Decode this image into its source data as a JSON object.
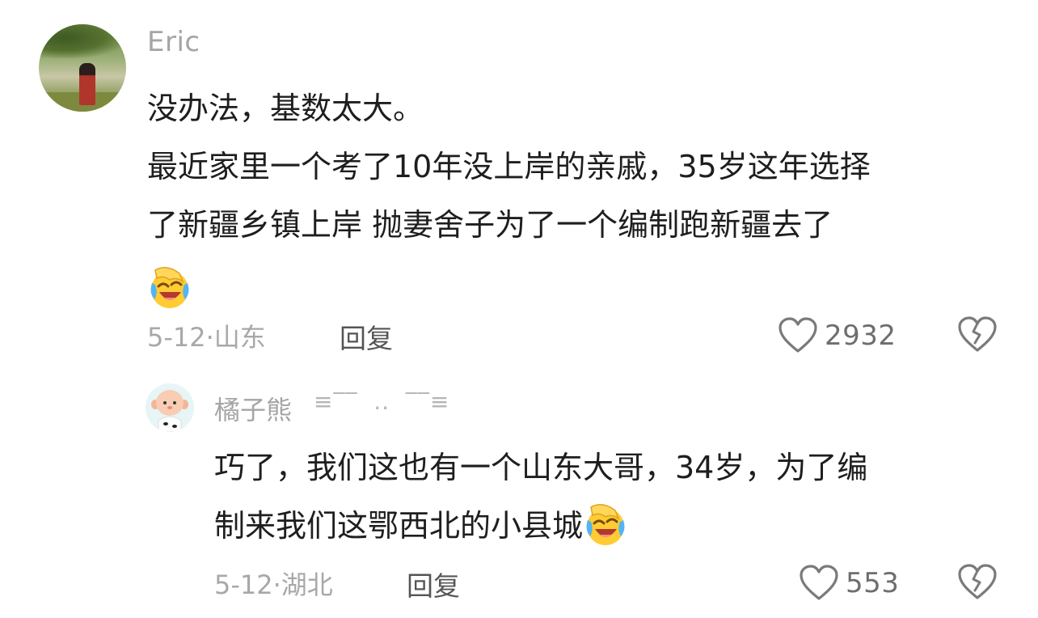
{
  "comment": {
    "username": "Eric",
    "lines": [
      "没办法，基数太大。",
      "最近家里一个考了10年没上岸的亲戚，35岁这年选择",
      "了新疆乡镇上岸 抛妻舍子为了一个编制跑新疆去了"
    ],
    "emoji": "😂",
    "date": "5-12",
    "separator": "·",
    "location": "山东",
    "reply_label": "回复",
    "like_count": "2932",
    "icons": {
      "like": "heart-outline-icon",
      "dislike": "broken-heart-icon",
      "emoji": "face-with-tears-of-joy-icon"
    }
  },
  "reply": {
    "username": "橘子熊",
    "username_deco": "≡‾‾  ..  ‾‾≡",
    "lines": [
      "巧了，我们这也有一个山东大哥，34岁，为了编",
      "制来我们这鄂西北的小县城"
    ],
    "emoji": "😂",
    "date": "5-12",
    "separator": "·",
    "location": "湖北",
    "reply_label": "回复",
    "like_count": "553",
    "icons": {
      "like": "heart-outline-icon",
      "dislike": "broken-heart-icon",
      "emoji": "face-with-tears-of-joy-icon"
    }
  },
  "colors": {
    "username": "#a5a5a5",
    "body_text": "#1e1e1e",
    "meta_text": "#a8a8a8",
    "reply_link": "#555555",
    "icon_stroke": "#7a7a7a"
  }
}
